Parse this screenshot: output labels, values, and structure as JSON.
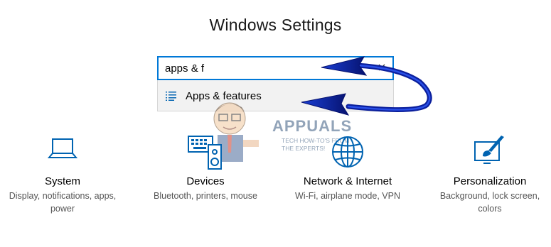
{
  "page": {
    "title": "Windows Settings"
  },
  "search": {
    "value": "apps & f"
  },
  "suggestions": [
    {
      "label": "Apps & features",
      "icon": "list-icon"
    }
  ],
  "tiles": [
    {
      "name": "System",
      "description": "Display, notifications, apps, power",
      "icon": "laptop-icon"
    },
    {
      "name": "Devices",
      "description": "Bluetooth, printers, mouse",
      "icon": "keyboard-speaker-icon"
    },
    {
      "name": "Network & Internet",
      "description": "Wi-Fi, airplane mode, VPN",
      "icon": "globe-icon"
    },
    {
      "name": "Personalization",
      "description": "Background, lock screen, colors",
      "icon": "paint-brush-icon"
    }
  ],
  "watermark": {
    "brand": "APPUALS",
    "tagline": "TECH HOW-TO'S FROM THE EXPERTS!"
  },
  "colors": {
    "accent": "#0078d7",
    "icon": "#0063b1",
    "annotation_arrow": "#0b1f9c"
  }
}
